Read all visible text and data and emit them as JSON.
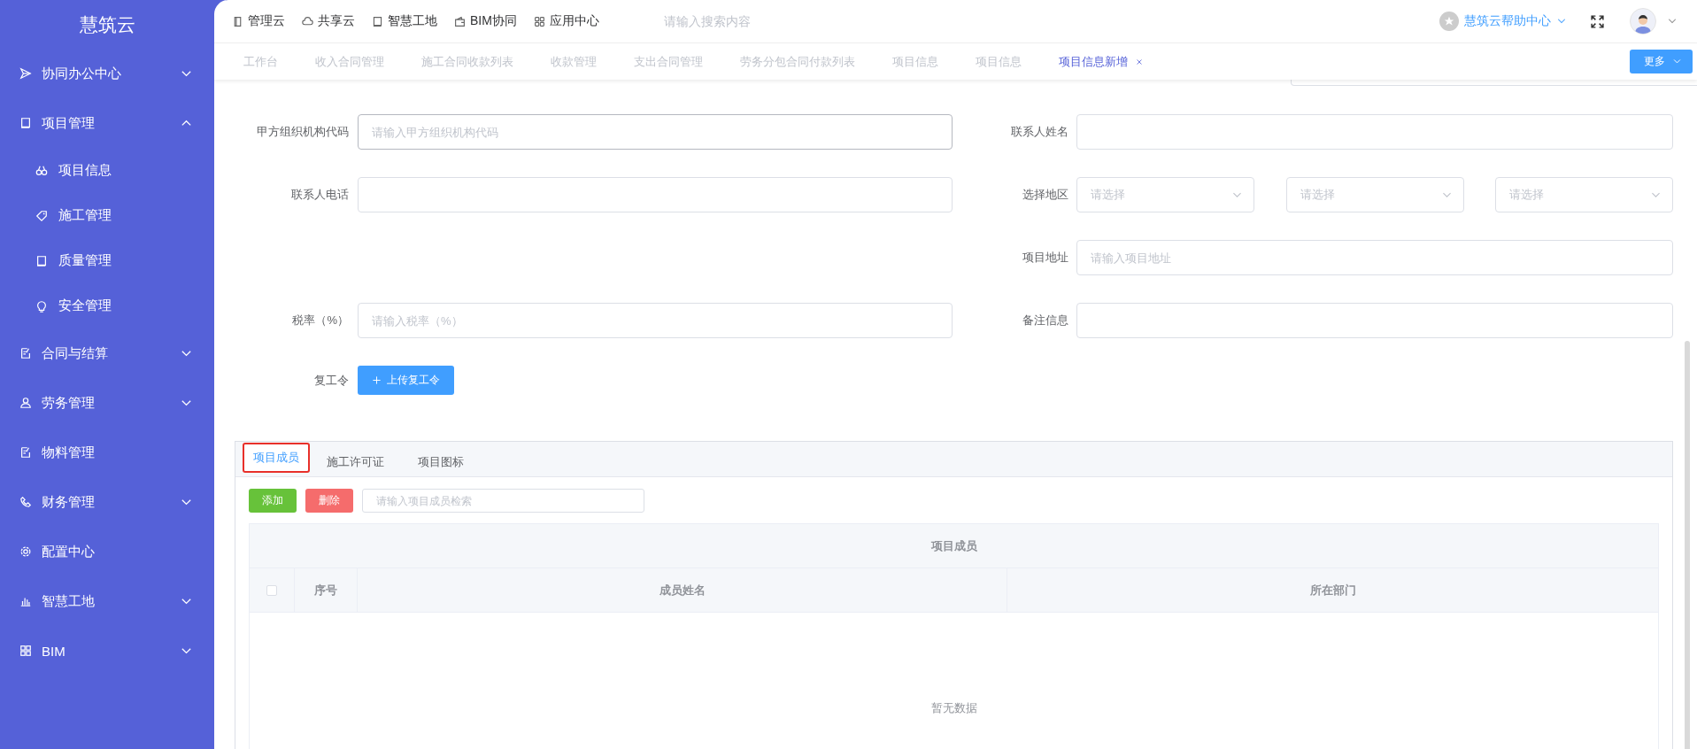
{
  "sidebar": {
    "title": "慧筑云",
    "items": [
      {
        "label": "协同办公中心",
        "kind": "group",
        "expanded": false
      },
      {
        "label": "项目管理",
        "kind": "group",
        "expanded": true,
        "children": [
          {
            "label": "项目信息"
          },
          {
            "label": "施工管理"
          },
          {
            "label": "质量管理"
          },
          {
            "label": "安全管理"
          }
        ]
      },
      {
        "label": "合同与结算",
        "kind": "group",
        "expanded": false
      },
      {
        "label": "劳务管理",
        "kind": "group",
        "expanded": false
      },
      {
        "label": "物料管理",
        "kind": "link"
      },
      {
        "label": "财务管理",
        "kind": "group",
        "expanded": false
      },
      {
        "label": "配置中心",
        "kind": "link"
      },
      {
        "label": "智慧工地",
        "kind": "group",
        "expanded": false
      },
      {
        "label": "BIM",
        "kind": "group",
        "expanded": false
      }
    ]
  },
  "top_bar": {
    "nav": [
      "管理云",
      "共享云",
      "智慧工地",
      "BIM协同",
      "应用中心"
    ],
    "search": {
      "placeholder": "请输入搜索内容"
    },
    "help_center": "慧筑云帮助中心"
  },
  "tabs": [
    {
      "label": "工作台",
      "selected": false,
      "closable": false
    },
    {
      "label": "收入合同管理",
      "selected": false,
      "closable": false
    },
    {
      "label": "施工合同收款列表",
      "selected": false,
      "closable": false
    },
    {
      "label": "收款管理",
      "selected": false,
      "closable": false
    },
    {
      "label": "支出合同管理",
      "selected": false,
      "closable": false
    },
    {
      "label": "劳务分包合同付款列表",
      "selected": false,
      "closable": false
    },
    {
      "label": "项目信息",
      "selected": false,
      "closable": false
    },
    {
      "label": "项目信息",
      "selected": false,
      "closable": false
    },
    {
      "label": "项目信息新增",
      "selected": true,
      "closable": true
    }
  ],
  "more_button": "更多",
  "form": {
    "rows": [
      [
        {
          "kind": "input",
          "label": "甲方组织机构代码",
          "placeholder": "请输入甲方组织机构代码"
        },
        {
          "kind": "input",
          "label": "联系人姓名"
        }
      ],
      [
        {
          "kind": "input",
          "label": "联系人电话"
        },
        {
          "kind": "region",
          "label": "选择地区",
          "selects": [
            {
              "placeholder": "请选择"
            },
            {
              "placeholder": "请选择"
            },
            {
              "placeholder": "请选择"
            }
          ]
        }
      ],
      [
        "",
        {
          "kind": "input",
          "label": "项目地址",
          "placeholder": "请输入项目地址"
        }
      ],
      [
        {
          "kind": "input",
          "label": "税率（%）",
          "placeholder": "请输入税率（%）"
        },
        {
          "kind": "input",
          "label": "备注信息"
        }
      ],
      [
        {
          "kind": "upload",
          "label": "复工令",
          "button": "上传复工令"
        }
      ]
    ]
  },
  "member_panel": {
    "tabs": [
      {
        "label": "项目成员",
        "selected": true
      },
      {
        "label": "施工许可证",
        "selected": false
      },
      {
        "label": "项目图标",
        "selected": false
      }
    ],
    "add_button": "添加",
    "delete_button": "删除",
    "search": {
      "placeholder": "请输入项目成员检索"
    },
    "table": {
      "title": "项目成员",
      "select_all_checked": false,
      "columns": [
        "序号",
        "成员姓名",
        "所在部门"
      ],
      "empty_text": "暂无数据"
    }
  }
}
